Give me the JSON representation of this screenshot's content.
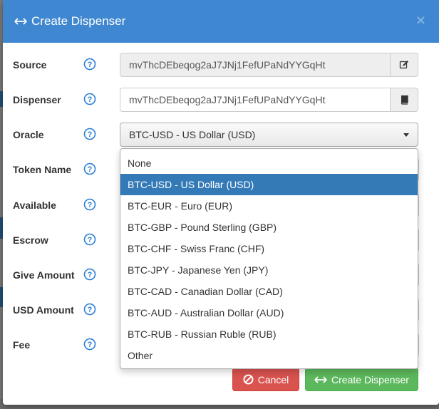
{
  "modal": {
    "title": "Create Dispenser",
    "close_glyph": "×"
  },
  "form": {
    "source": {
      "label": "Source",
      "value": "mvThcDEbeqog2aJ7JNj1FefUPaNdYYGqHt"
    },
    "dispenser": {
      "label": "Dispenser",
      "value": "mvThcDEbeqog2aJ7JNj1FefUPaNdYYGqHt"
    },
    "oracle": {
      "label": "Oracle",
      "value": "BTC-USD - US Dollar (USD)"
    },
    "token_name": {
      "label": "Token Name"
    },
    "available": {
      "label": "Available"
    },
    "escrow": {
      "label": "Escrow"
    },
    "give_amount": {
      "label": "Give Amount"
    },
    "usd_amount": {
      "label": "USD Amount"
    },
    "fee": {
      "label": "Fee"
    }
  },
  "oracle_options": [
    "None",
    "BTC-USD - US Dollar (USD)",
    "BTC-EUR - Euro (EUR)",
    "BTC-GBP - Pound Sterling (GBP)",
    "BTC-CHF - Swiss Franc (CHF)",
    "BTC-JPY - Japanese Yen (JPY)",
    "BTC-CAD - Canadian Dollar (CAD)",
    "BTC-AUD - Australian Dollar (AUD)",
    "BTC-RUB - Russian Ruble (RUB)",
    "Other"
  ],
  "selected_option": "BTC-USD - US Dollar (USD)",
  "buttons": {
    "cancel": "Cancel",
    "create": "Create Dispenser"
  },
  "icons": {
    "header": "double-arrow-icon",
    "help": "question-circle-icon",
    "source_addon": "edit-icon",
    "dispenser_addon": "book-icon",
    "cancel": "ban-icon",
    "create": "double-arrow-icon"
  },
  "colors": {
    "header_bg": "#3f87d0",
    "help_icon": "#2a7fd4",
    "selected_option": "#337ab7",
    "cancel_button": "#d9534f",
    "create_button": "#5cb85c"
  }
}
